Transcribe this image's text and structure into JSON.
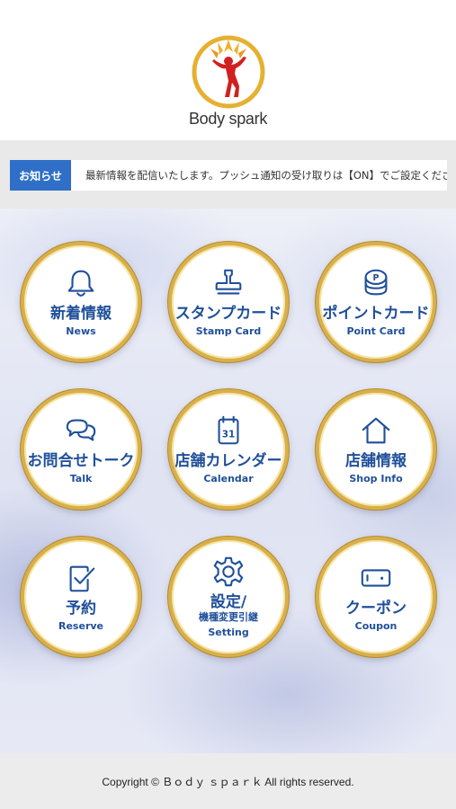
{
  "header": {
    "logo_text": "Body spark",
    "logo_icon": "flame-figure-logo"
  },
  "news": {
    "badge": "お知らせ",
    "text": "最新情報を配信いたします。プッシュ通知の受け取りは【ON】でご設定ください。"
  },
  "menu": [
    {
      "jp": "新着情報",
      "en": "News",
      "icon": "bell-icon"
    },
    {
      "jp": "スタンプカード",
      "en": "Stamp Card",
      "icon": "stamp-icon"
    },
    {
      "jp": "ポイントカード",
      "en": "Point Card",
      "icon": "coin-stack-icon"
    },
    {
      "jp": "お問合せトーク",
      "en": "Talk",
      "icon": "chat-bubbles-icon"
    },
    {
      "jp": "店舗カレンダー",
      "en": "Calendar",
      "icon": "calendar-icon"
    },
    {
      "jp": "店舗情報",
      "en": "Shop Info",
      "icon": "home-icon"
    },
    {
      "jp": "予約",
      "en": "Reserve",
      "icon": "checklist-icon"
    },
    {
      "jp": "設定/",
      "jp_sub": "機種変更引継",
      "en": "Setting",
      "icon": "gear-icon"
    },
    {
      "jp": "クーポン",
      "en": "Coupon",
      "icon": "ticket-icon"
    }
  ],
  "calendar_day": "31",
  "point_letter": "P",
  "footer": {
    "copyright": "Copyright © Ｂｏｄｙ ｓｐａｒｋ All rights reserved."
  },
  "colors": {
    "accent": "#2f6fc7",
    "icon_blue": "#1f4f9a",
    "gold": "#d8b04a"
  }
}
